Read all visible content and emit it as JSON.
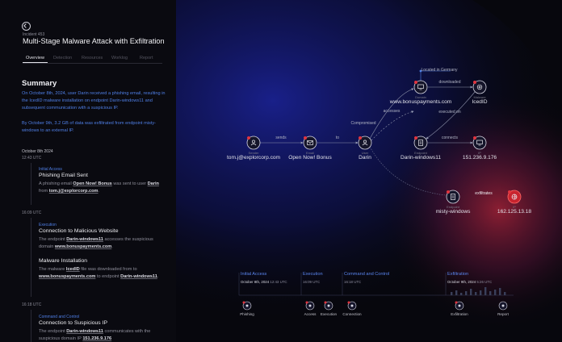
{
  "incident": {
    "id": "Incident 453",
    "title": "Multi-Stage Malware Attack with Exfiltration"
  },
  "tabs": [
    {
      "label": "Overview",
      "active": true
    },
    {
      "label": "Detection",
      "active": false
    },
    {
      "label": "Resources",
      "active": false
    },
    {
      "label": "Worklog",
      "active": false
    },
    {
      "label": "Report",
      "active": false
    }
  ],
  "summary": {
    "heading": "Summary",
    "p1": "On October 8th, 2024, user Darin received a phishing email, resulting in the IcedID malware installation on endpoint Darin-windows11 and subsequent communication with a suspicious IP.",
    "p2": "By October 9th, 3.2 GB of data was exfiltrated from endpoint misty-windows to an external IP."
  },
  "timeline": {
    "date": "October 8th 2024",
    "groups": [
      {
        "time": "12:43 UTC",
        "events": [
          {
            "category": "Initial Access",
            "title": "Phishing Email Sent",
            "body": [
              {
                "t": "A phishing email "
              },
              {
                "b": "Open Now! Bonus"
              },
              {
                "t": " was sent to user "
              },
              {
                "b": "Darin"
              },
              {
                "t": " from "
              },
              {
                "b": "tom.j@explorcorp.com"
              },
              {
                "t": "."
              }
            ]
          }
        ]
      },
      {
        "time": "16:09 UTC",
        "events": [
          {
            "category": "Execution",
            "title": "Connection to Malicious Website",
            "body": [
              {
                "t": "The endpoint "
              },
              {
                "b": "Darin-windows11"
              },
              {
                "t": " accesses the suspicious domain "
              },
              {
                "b": "www.bonuspayments.com"
              },
              {
                "t": "."
              }
            ]
          },
          {
            "category": "",
            "title": "Malware Installation",
            "body": [
              {
                "t": "The malware "
              },
              {
                "b": "IcedID"
              },
              {
                "t": " file was downloaded from to "
              },
              {
                "b": "www.bonuspayments.com"
              },
              {
                "t": " to endpoint "
              },
              {
                "b": "Darin-windows11"
              },
              {
                "t": "."
              }
            ]
          }
        ]
      },
      {
        "time": "16:18 UTC",
        "events": [
          {
            "category": "Command and Control",
            "title": "Connection to Suspicious IP",
            "body": [
              {
                "t": "The endpoint "
              },
              {
                "b": "Darin-windows11"
              },
              {
                "t": " communicates with the suspicious domain IP "
              },
              {
                "b": "151.236.9.176"
              }
            ]
          }
        ]
      }
    ]
  },
  "graph": {
    "nodes": [
      {
        "id": "sender",
        "type": "Sender",
        "name": "tom.j@explorcorp.com",
        "icon": "person-icon",
        "alert": true
      },
      {
        "id": "email",
        "type": "Email",
        "name": "Open Now! Bonus",
        "icon": "envelope-icon",
        "alert": true
      },
      {
        "id": "user",
        "type": "User",
        "name": "Darin",
        "icon": "person-icon",
        "alert": true
      },
      {
        "id": "domain",
        "type": "Domain",
        "name": "www.bonuspayments.com",
        "icon": "monitor-icon",
        "alert": true
      },
      {
        "id": "malware",
        "type": "Malware",
        "name": "IcedID",
        "icon": "gear-icon",
        "alert": true
      },
      {
        "id": "endpoint1",
        "type": "Endpoint",
        "name": "Darin-windows11",
        "icon": "document-icon",
        "alert": true
      },
      {
        "id": "ip1",
        "type": "IP",
        "name": "151.236.9.176",
        "icon": "monitor-icon",
        "alert": true
      },
      {
        "id": "endpoint2",
        "type": "Endpoint",
        "name": "misty-windows",
        "icon": "document-icon",
        "alert": true
      },
      {
        "id": "ip2",
        "type": "IP",
        "name": "162.125.13.18",
        "icon": "globe-icon",
        "alert": true
      }
    ],
    "edges": [
      {
        "label": "sends"
      },
      {
        "label": "to"
      },
      {
        "label": "Compromised"
      },
      {
        "label": "accesses"
      },
      {
        "label": "downloaded"
      },
      {
        "label": "executed on"
      },
      {
        "label": "connects"
      },
      {
        "label": "exfiltrates"
      }
    ],
    "annotation": "Located in Germany"
  },
  "phase_timeline": {
    "phases": [
      {
        "name": "Initial Access",
        "date": "October 8th, 2024",
        "time": "12:43 UTC"
      },
      {
        "name": "Execution",
        "date": "",
        "time": "16:09 UTC"
      },
      {
        "name": "Command and Control",
        "date": "",
        "time": "16:18 UTC"
      },
      {
        "name": "Exfiltration",
        "date": "October 9th, 2024",
        "time": "5:26 UTC"
      }
    ],
    "icons": [
      {
        "label": "Phishing",
        "icon": "phishing-icon"
      },
      {
        "label": "Access",
        "icon": "cursor-icon"
      },
      {
        "label": "Execution",
        "icon": "gear-icon"
      },
      {
        "label": "Connection",
        "icon": "monitor-icon"
      },
      {
        "label": "Exfiltration",
        "icon": "upload-icon"
      },
      {
        "label": "Report",
        "icon": "report-icon"
      }
    ]
  },
  "colors": {
    "accent_blue": "#4f7fe6",
    "alert_red": "#e2343e",
    "background": "#07070d"
  }
}
